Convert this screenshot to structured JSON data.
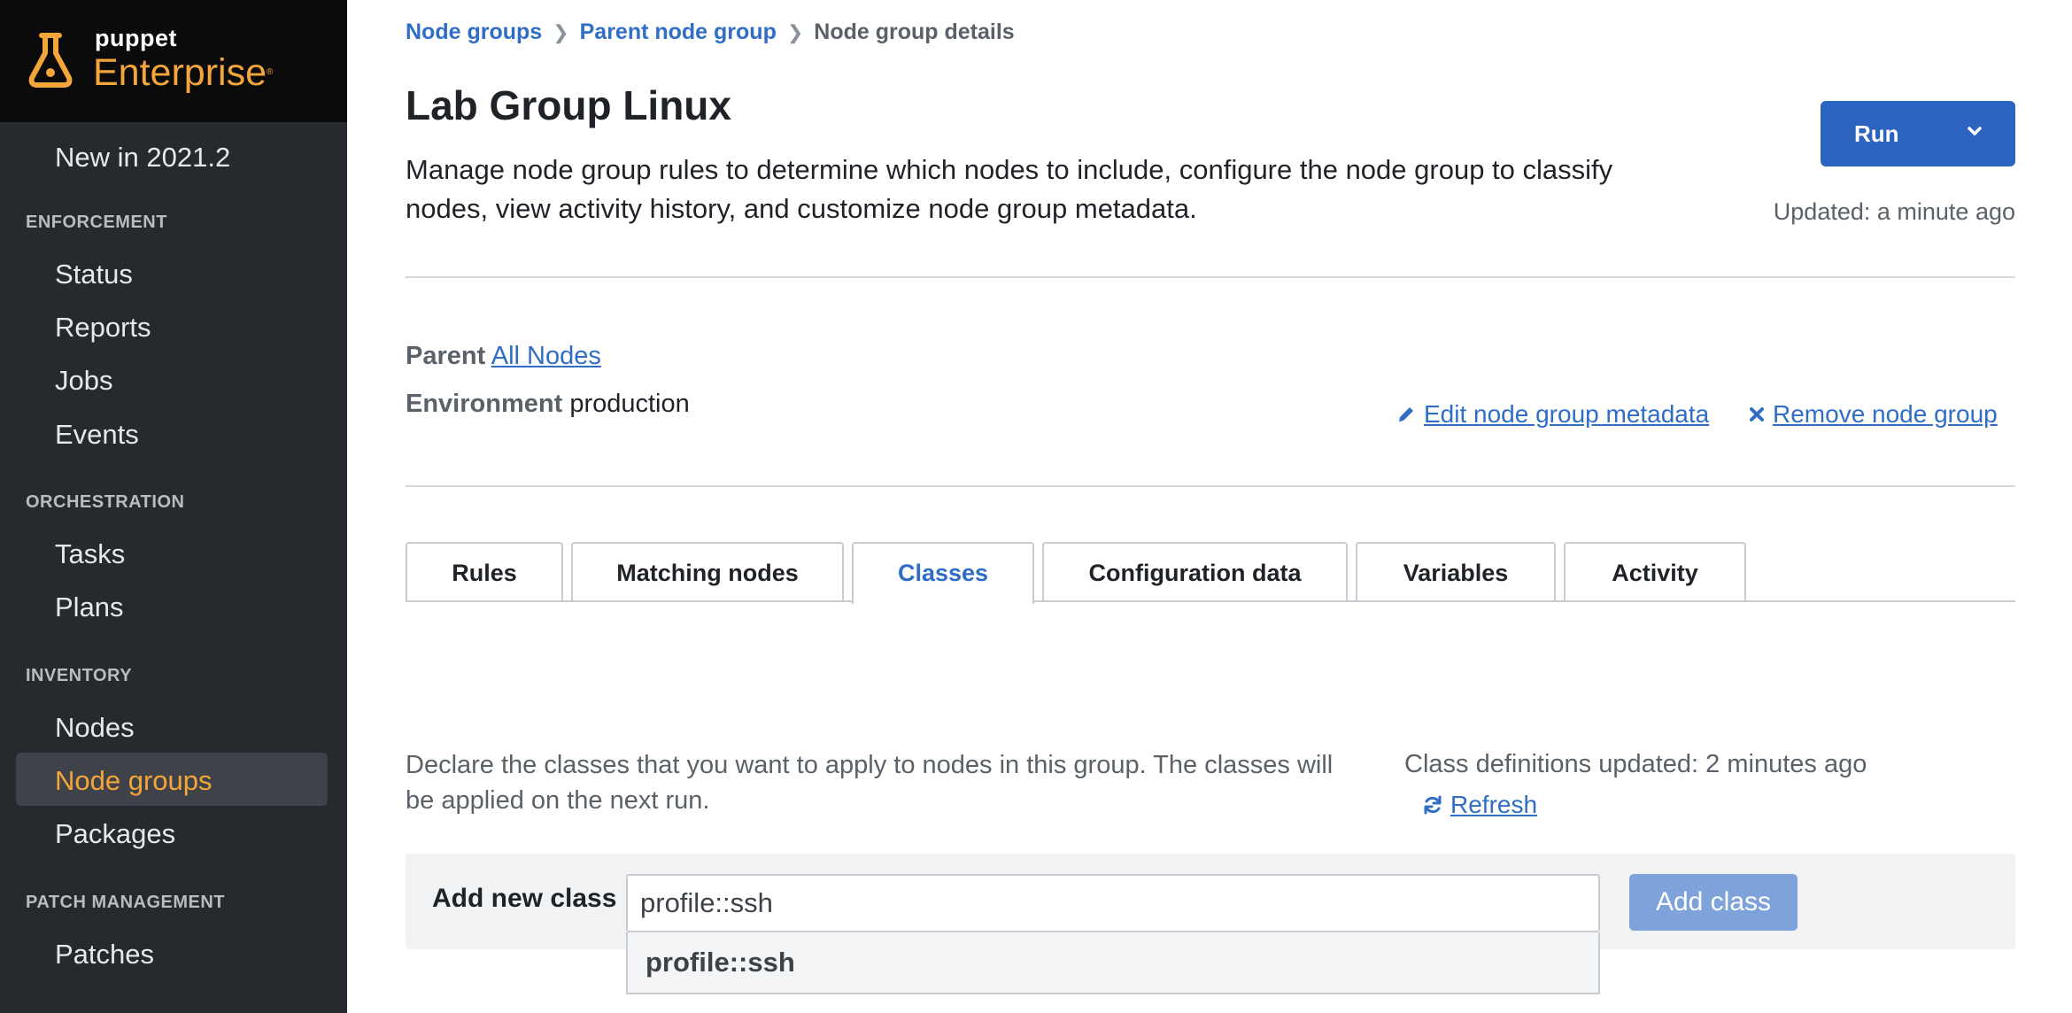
{
  "sidebar": {
    "logo_small": "puppet",
    "logo_big": "Enterprise",
    "logo_mark": "®",
    "new_label": "New in 2021.2",
    "sections": [
      {
        "title": "ENFORCEMENT",
        "items": [
          "Status",
          "Reports",
          "Jobs",
          "Events"
        ]
      },
      {
        "title": "ORCHESTRATION",
        "items": [
          "Tasks",
          "Plans"
        ]
      },
      {
        "title": "INVENTORY",
        "items": [
          "Nodes",
          "Node groups",
          "Packages"
        ]
      },
      {
        "title": "PATCH MANAGEMENT",
        "items": [
          "Patches"
        ]
      }
    ],
    "active_item": "Node groups"
  },
  "breadcrumb": [
    "Node groups",
    "Parent node group",
    "Node group details"
  ],
  "page": {
    "title": "Lab Group Linux",
    "description": "Manage node group rules to determine which nodes to include, configure the node group to classify nodes, view activity history, and customize node group metadata.",
    "run_label": "Run",
    "updated": "Updated: a minute ago"
  },
  "metadata": {
    "parent_label": "Parent",
    "parent_value": "All Nodes",
    "environment_label": "Environment",
    "environment_value": "production",
    "edit_link": "Edit node group metadata",
    "remove_link": "Remove node group"
  },
  "tabs": [
    "Rules",
    "Matching nodes",
    "Classes",
    "Configuration data",
    "Variables",
    "Activity"
  ],
  "active_tab": "Classes",
  "classes": {
    "description": "Declare the classes that you want to apply to nodes in this group. The classes will be applied on the next run.",
    "definitions_updated": "Class definitions updated: 2 minutes ago",
    "refresh_label": "Refresh",
    "add_label": "Add new class",
    "input_value": "profile::ssh",
    "add_button": "Add class",
    "suggestions": [
      "profile::ssh"
    ]
  },
  "colors": {
    "accent": "#2c63c1",
    "link": "#2f6dc7",
    "brand_orange": "#f4a63a",
    "sidebar_bg": "#26292d"
  }
}
